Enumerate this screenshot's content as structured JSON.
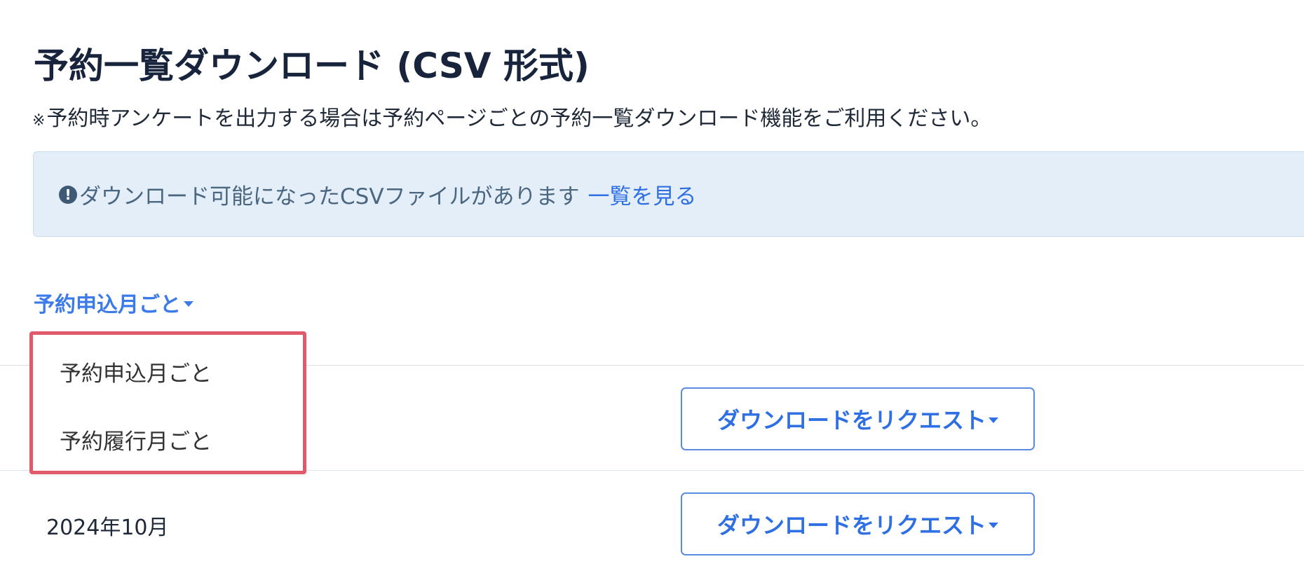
{
  "header": {
    "title": "予約一覧ダウンロード (CSV 形式)",
    "note_mark": "※",
    "note": "予約時アンケートを出力する場合は予約ページごとの予約一覧ダウンロード機能をご利用ください。"
  },
  "alert": {
    "icon": "exclamation-circle-icon",
    "icon_glyph": "!",
    "text": "ダウンロード可能になったCSVファイルがあります",
    "link_label": "一覧を見る"
  },
  "mode_selector": {
    "label": "予約申込月ごと",
    "options": [
      "予約申込月ごと",
      "予約履行月ごと"
    ]
  },
  "rows": [
    {
      "month": "",
      "button_label": "ダウンロードをリクエスト"
    },
    {
      "month": "2024年10月",
      "button_label": "ダウンロードをリクエスト"
    }
  ],
  "colors": {
    "link_blue": "#2f6fe4",
    "alert_bg": "#e3eef8",
    "highlight_border": "#e05a6c"
  }
}
